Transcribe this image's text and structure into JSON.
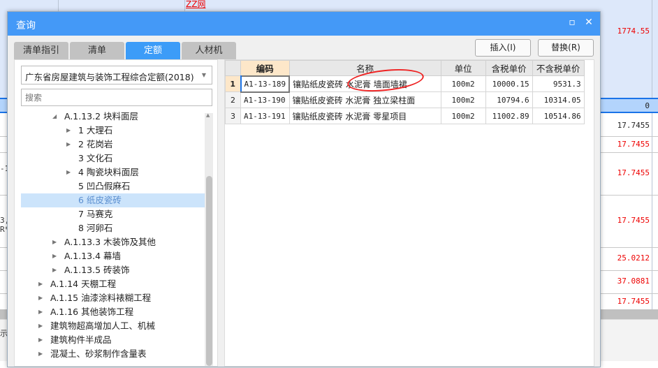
{
  "background": {
    "top_link": "ZZ网",
    "top_value": "1774.55",
    "header_value": "0",
    "row_values": [
      "17.7455",
      "17.7455",
      "17.7455",
      "17.7455",
      "25.0212",
      "37.0881",
      "17.7455"
    ],
    "fragments": [
      "-1",
      "3,",
      "R*",
      "示"
    ]
  },
  "dialog": {
    "title": "查询",
    "tabs": [
      "清单指引",
      "清单",
      "定额",
      "人材机"
    ],
    "active_tab": "定额",
    "insert_button": "插入(I)",
    "replace_button": "替换(R)",
    "library_select": "广东省房屋建筑与装饰工程综合定额(2018)",
    "search_placeholder": "搜索",
    "tree": [
      {
        "label": "A.1.13.2 块料面层",
        "level": 2,
        "caret": "expanded"
      },
      {
        "label": "1 大理石",
        "level": 3,
        "caret": "collapsed"
      },
      {
        "label": "2 花岗岩",
        "level": 3,
        "caret": "collapsed"
      },
      {
        "label": "3 文化石",
        "level": 3,
        "caret": ""
      },
      {
        "label": "4 陶瓷块料面层",
        "level": 3,
        "caret": "collapsed"
      },
      {
        "label": "5 凹凸假麻石",
        "level": 3,
        "caret": ""
      },
      {
        "label": "6 纸皮瓷砖",
        "level": 3,
        "caret": "",
        "selected": true
      },
      {
        "label": "7 马赛克",
        "level": 3,
        "caret": ""
      },
      {
        "label": "8 河卵石",
        "level": 3,
        "caret": ""
      },
      {
        "label": "A.1.13.3 木装饰及其他",
        "level": 2,
        "caret": "collapsed"
      },
      {
        "label": "A.1.13.4 幕墙",
        "level": 2,
        "caret": "collapsed"
      },
      {
        "label": "A.1.13.5 砖装饰",
        "level": 2,
        "caret": "collapsed"
      },
      {
        "label": "A.1.14 天棚工程",
        "level": 1,
        "caret": "collapsed"
      },
      {
        "label": "A.1.15 油漆涂料裱糊工程",
        "level": 1,
        "caret": "collapsed"
      },
      {
        "label": "A.1.16 其他装饰工程",
        "level": 1,
        "caret": "collapsed"
      },
      {
        "label": "建筑物超高增加人工、机械",
        "level": 1,
        "caret": "collapsed"
      },
      {
        "label": "建筑构件半成品",
        "level": 1,
        "caret": "collapsed"
      },
      {
        "label": "混凝土、砂浆制作含量表",
        "level": 1,
        "caret": "collapsed"
      }
    ],
    "table": {
      "headers": [
        "编码",
        "名称",
        "单位",
        "含税单价",
        "不含税单价"
      ],
      "rows": [
        {
          "index": "1",
          "code": "A1-13-189",
          "name": "镶贴纸皮瓷砖 水泥膏 墙面墙裙",
          "unit": "100m2",
          "tax_price": "10000.15",
          "notax_price": "9531.3"
        },
        {
          "index": "2",
          "code": "A1-13-190",
          "name": "镶贴纸皮瓷砖 水泥膏 独立梁柱面",
          "unit": "100m2",
          "tax_price": "10794.6",
          "notax_price": "10314.05"
        },
        {
          "index": "3",
          "code": "A1-13-191",
          "name": "镶贴纸皮瓷砖 水泥膏 零星项目",
          "unit": "100m2",
          "tax_price": "11002.89",
          "notax_price": "10514.86"
        }
      ]
    }
  }
}
